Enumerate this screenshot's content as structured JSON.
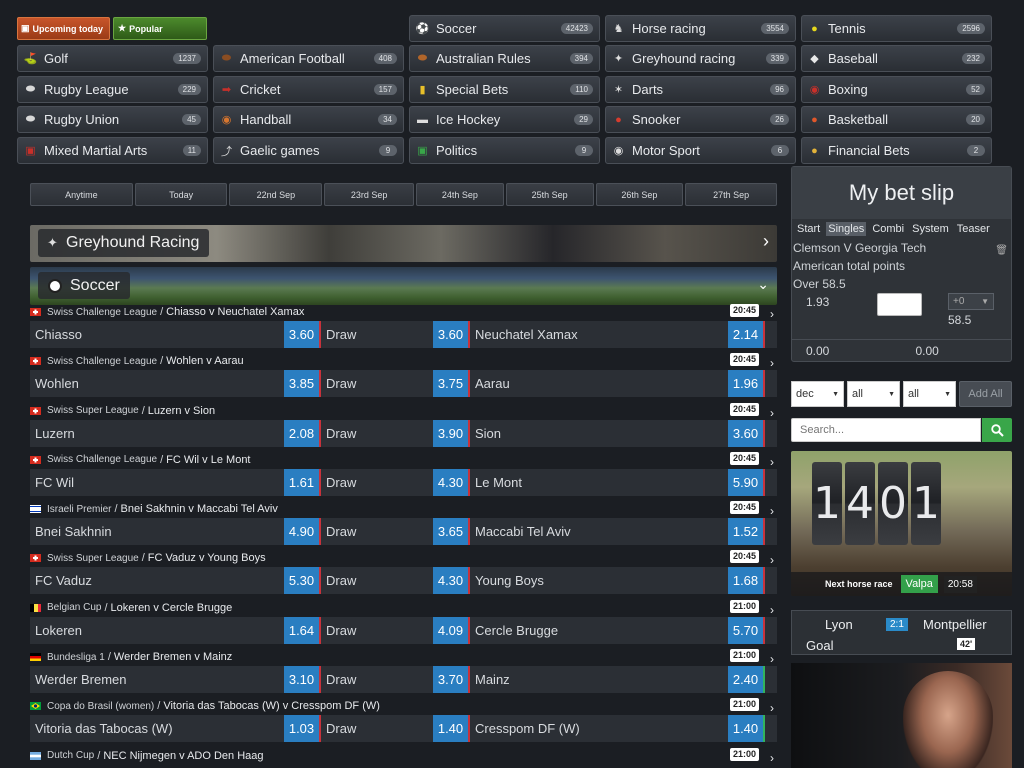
{
  "top_buttons": {
    "upcoming": "Upcoming today",
    "popular": "Popular"
  },
  "sports": [
    {
      "name": "Soccer",
      "count": "42423",
      "icon": "soccer-ball-icon"
    },
    {
      "name": "Horse racing",
      "count": "3554",
      "icon": "horse-icon"
    },
    {
      "name": "Tennis",
      "count": "2596",
      "icon": "tennis-ball-icon"
    },
    {
      "name": "Golf",
      "count": "1237",
      "icon": "golf-icon"
    },
    {
      "name": "American Football",
      "count": "408",
      "icon": "american-football-icon"
    },
    {
      "name": "Australian Rules",
      "count": "394",
      "icon": "australian-rules-icon"
    },
    {
      "name": "Greyhound racing",
      "count": "339",
      "icon": "greyhound-icon"
    },
    {
      "name": "Baseball",
      "count": "232",
      "icon": "baseball-icon"
    },
    {
      "name": "Rugby League",
      "count": "229",
      "icon": "rugby-ball-icon"
    },
    {
      "name": "Cricket",
      "count": "157",
      "icon": "cricket-icon"
    },
    {
      "name": "Special Bets",
      "count": "110",
      "icon": "ticket-icon"
    },
    {
      "name": "Darts",
      "count": "96",
      "icon": "darts-icon"
    },
    {
      "name": "Boxing",
      "count": "52",
      "icon": "boxing-glove-icon"
    },
    {
      "name": "Rugby Union",
      "count": "45",
      "icon": "rugby-ball-icon"
    },
    {
      "name": "Handball",
      "count": "34",
      "icon": "handball-icon"
    },
    {
      "name": "Ice Hockey",
      "count": "29",
      "icon": "ice-hockey-puck-icon"
    },
    {
      "name": "Snooker",
      "count": "26",
      "icon": "snooker-balls-icon"
    },
    {
      "name": "Basketball",
      "count": "20",
      "icon": "basketball-icon"
    },
    {
      "name": "Mixed Martial Arts",
      "count": "11",
      "icon": "mma-icon"
    },
    {
      "name": "Gaelic games",
      "count": "9",
      "icon": "hurling-stick-icon"
    },
    {
      "name": "Politics",
      "count": "9",
      "icon": "ballot-icon"
    },
    {
      "name": "Motor Sport",
      "count": "6",
      "icon": "motor-sport-icon"
    },
    {
      "name": "Financial Bets",
      "count": "2",
      "icon": "coins-icon"
    }
  ],
  "dates": [
    "Anytime",
    "Today",
    "22nd Sep",
    "23rd Sep",
    "24th Sep",
    "25th Sep",
    "26th Sep",
    "27th Sep"
  ],
  "banners": {
    "greyhound": "Greyhound Racing",
    "soccer": "Soccer"
  },
  "draw_label": "Draw",
  "matches": [
    {
      "league": "Swiss Challenge League",
      "event": "Chiasso v Neuchatel Xamax",
      "time": "20:45",
      "flag": "ch",
      "home": "Chiasso",
      "h": "3.60",
      "d": "3.60",
      "away": "Neuchatel Xamax",
      "a": "2.14"
    },
    {
      "league": "Swiss Challenge League",
      "event": "Wohlen v Aarau",
      "time": "20:45",
      "flag": "ch",
      "home": "Wohlen",
      "h": "3.85",
      "d": "3.75",
      "away": "Aarau",
      "a": "1.96"
    },
    {
      "league": "Swiss Super League",
      "event": "Luzern v Sion",
      "time": "20:45",
      "flag": "ch",
      "home": "Luzern",
      "h": "2.08",
      "d": "3.90",
      "away": "Sion",
      "a": "3.60"
    },
    {
      "league": "Swiss Challenge League",
      "event": "FC Wil v Le Mont",
      "time": "20:45",
      "flag": "ch",
      "home": "FC Wil",
      "h": "1.61",
      "d": "4.30",
      "away": "Le Mont",
      "a": "5.90"
    },
    {
      "league": "Israeli Premier",
      "event": "Bnei Sakhnin v Maccabi Tel Aviv",
      "time": "20:45",
      "flag": "il",
      "home": "Bnei Sakhnin",
      "h": "4.90",
      "d": "3.65",
      "away": "Maccabi Tel Aviv",
      "a": "1.52"
    },
    {
      "league": "Swiss Super League",
      "event": "FC Vaduz v Young Boys",
      "time": "20:45",
      "flag": "ch",
      "home": "FC Vaduz",
      "h": "5.30",
      "d": "4.30",
      "away": "Young Boys",
      "a": "1.68"
    },
    {
      "league": "Belgian Cup",
      "event": "Lokeren v Cercle Brugge",
      "time": "21:00",
      "flag": "be",
      "home": "Lokeren",
      "h": "1.64",
      "d": "4.09",
      "away": "Cercle Brugge",
      "a": "5.70"
    },
    {
      "league": "Bundesliga 1",
      "event": "Werder Bremen v Mainz",
      "time": "21:00",
      "flag": "de",
      "home": "Werder Bremen",
      "h": "3.10",
      "d": "3.70",
      "away": "Mainz",
      "a": "2.40"
    },
    {
      "league": "Copa do Brasil (women)",
      "event": "Vitoria das Tabocas (W) v Cresspom DF (W)",
      "time": "21:00",
      "flag": "br",
      "home": "Vitoria das Tabocas (W)",
      "h": "1.03",
      "d": "1.40",
      "away": "Cresspom DF (W)",
      "a": "1.40"
    },
    {
      "league": "Dutch Cup",
      "event": "NEC Nijmegen v ADO Den Haag",
      "time": "21:00",
      "flag": "ar",
      "home": "",
      "h": "",
      "d": "",
      "away": "",
      "a": ""
    }
  ],
  "bet_slip": {
    "title": "My bet slip",
    "tabs": [
      "Start",
      "Singles",
      "Combi",
      "System",
      "Teaser"
    ],
    "active_tab": "Singles",
    "event": "Clemson V Georgia Tech",
    "market": "American total points",
    "selection": "Over 58.5",
    "odds": "1.93",
    "stake_value": "",
    "plus_select": "+0",
    "line": "58.5",
    "total_stake": "0.00",
    "total_return": "0.00"
  },
  "filters": {
    "sort": "dec",
    "f1": "all",
    "f2": "all",
    "add_all": "Add All"
  },
  "search": {
    "placeholder": "Search..."
  },
  "next_race": {
    "digits": [
      "1",
      "4",
      "0",
      "1"
    ],
    "label": "Next horse race",
    "venue": "Valpa",
    "time": "20:58"
  },
  "live": {
    "home": "Lyon",
    "away": "Montpellier",
    "score": "2:1",
    "event": "Goal",
    "minute": "42'"
  }
}
